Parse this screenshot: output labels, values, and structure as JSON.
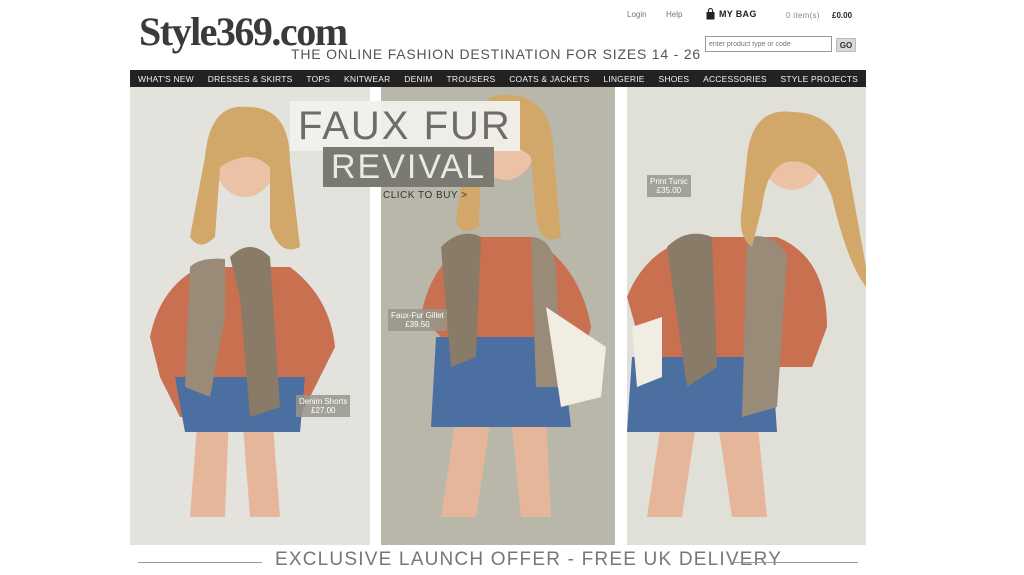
{
  "brand": {
    "logo": "Style369.com",
    "tagline": "THE ONLINE FASHION DESTINATION FOR SIZES 14 - 26"
  },
  "account": {
    "login": "Login",
    "help": "Help",
    "bag_label": "MY BAG",
    "items": "0 item(s)",
    "total": "£0.00"
  },
  "search": {
    "placeholder": "enter product type or code",
    "button": "GO"
  },
  "nav": [
    "WHAT'S NEW",
    "DRESSES & SKIRTS",
    "TOPS",
    "KNITWEAR",
    "DENIM",
    "TROUSERS",
    "COATS & JACKETS",
    "LINGERIE",
    "SHOES",
    "ACCESSORIES",
    "STYLE PROJECTS"
  ],
  "hero": {
    "headline_line1": "FAUX FUR",
    "headline_line2": "REVIVAL",
    "cta": "CLICK TO BUY >",
    "tags": [
      {
        "name": "Denim Shorts",
        "price": "£27.00"
      },
      {
        "name": "Faux-Fur Gillet",
        "price": "£39.50"
      },
      {
        "name": "Print Tunic",
        "price": "£35.00"
      }
    ]
  },
  "promo": {
    "offer": "EXCLUSIVE LAUNCH OFFER - FREE UK DELIVERY"
  },
  "colors": {
    "nav_bg": "#222222",
    "panel_light": "#e3e2dc",
    "panel_mid": "#b9b7aa",
    "shirt": "#c8704f",
    "denim": "#4a6fa0",
    "fur": "#8a7a68"
  }
}
